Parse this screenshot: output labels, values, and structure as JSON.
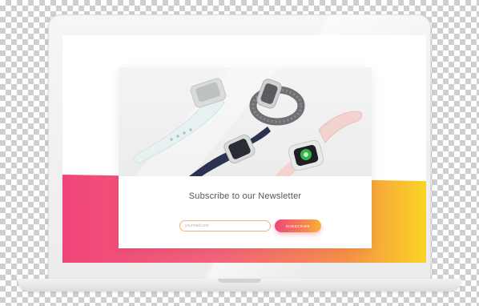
{
  "newsletter": {
    "title": "Subscribe to our Newsletter",
    "email_placeholder": "yourmail.com",
    "email_value": "",
    "subscribe_label": "SUBSCRIBE"
  },
  "colors": {
    "gradient_pink": "#f0457a",
    "gradient_orange": "#f6804f",
    "gradient_yellow": "#f9d423",
    "input_border": "#f0b27a",
    "title_text": "#555555"
  },
  "icons": {
    "watch_white": "white-smartwatch-icon",
    "watch_navy": "navy-leather-smartwatch-icon",
    "watch_grey": "grey-woven-smartwatch-icon",
    "watch_pink": "pink-sport-smartwatch-icon"
  }
}
